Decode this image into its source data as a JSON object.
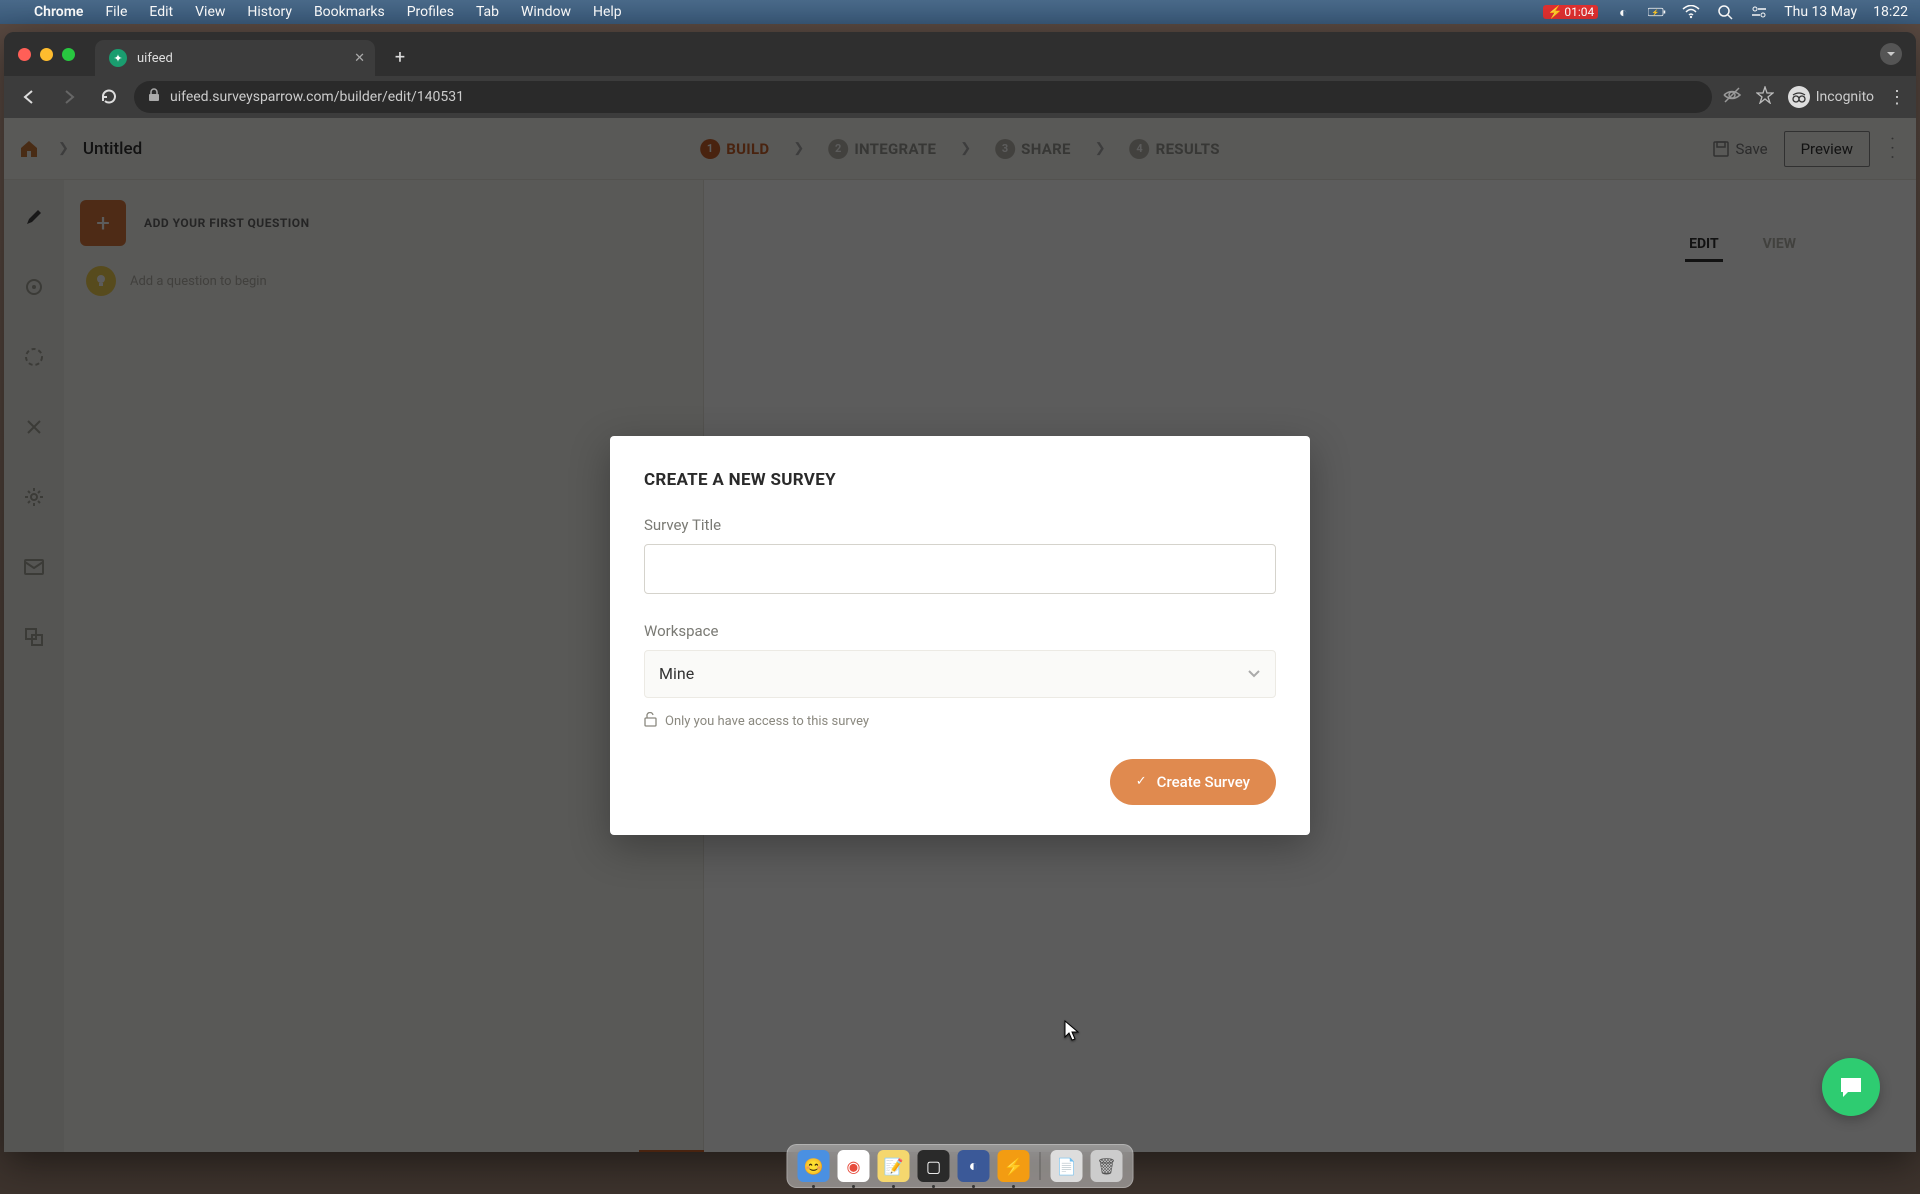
{
  "menubar": {
    "app": "Chrome",
    "items": [
      "File",
      "Edit",
      "View",
      "History",
      "Bookmarks",
      "Profiles",
      "Tab",
      "Window",
      "Help"
    ],
    "battery_time": "01:04",
    "date": "Thu 13 May",
    "time": "18:22"
  },
  "browser": {
    "tab_title": "uifeed",
    "url": "uifeed.surveysparrow.com/builder/edit/140531",
    "profile_label": "Incognito"
  },
  "app": {
    "breadcrumb_title": "Untitled",
    "steps": [
      {
        "num": "1",
        "label": "BUILD",
        "active": true
      },
      {
        "num": "2",
        "label": "INTEGRATE",
        "active": false
      },
      {
        "num": "3",
        "label": "SHARE",
        "active": false
      },
      {
        "num": "4",
        "label": "RESULTS",
        "active": false
      }
    ],
    "save_label": "Save",
    "preview_label": "Preview",
    "add_question_label": "ADD YOUR FIRST QUESTION",
    "hint_text": "Add a question to begin",
    "pane_tabs": {
      "edit": "EDIT",
      "view": "VIEW"
    }
  },
  "modal": {
    "title": "CREATE A NEW SURVEY",
    "field_title_label": "Survey Title",
    "field_title_value": "",
    "workspace_label": "Workspace",
    "workspace_value": "Mine",
    "access_note": "Only you have access to this survey",
    "create_label": "Create Survey"
  }
}
